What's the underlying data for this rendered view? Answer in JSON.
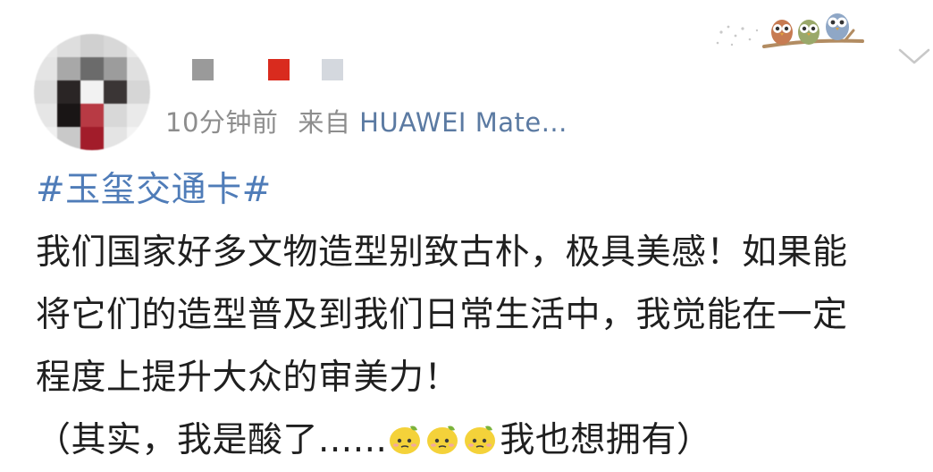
{
  "post": {
    "timestamp": "10分钟前",
    "source_prefix": "来自",
    "source_device": "HUAWEI Mate...",
    "hashtag": "#玉玺交通卡#",
    "lines": [
      "我们国家好多文物造型别致古朴，极具美感！如果能",
      "将它们的造型普及到我们日常生活中，我觉能在一定",
      "程度上提升大众的审美力！"
    ],
    "last_line_start": "（其实，我是酸了......",
    "last_line_end": "我也想拥有）",
    "emoji": [
      "lemon-emoji",
      "lemon-emoji",
      "lemon-emoji"
    ]
  },
  "colors": {
    "link": "#5b7aa2",
    "hashtag": "#4f7cb8",
    "meta_gray": "#8d8d8d"
  },
  "icons": [
    "owl-decoration-icon",
    "chevron-down-icon",
    "lemon-emoji"
  ]
}
